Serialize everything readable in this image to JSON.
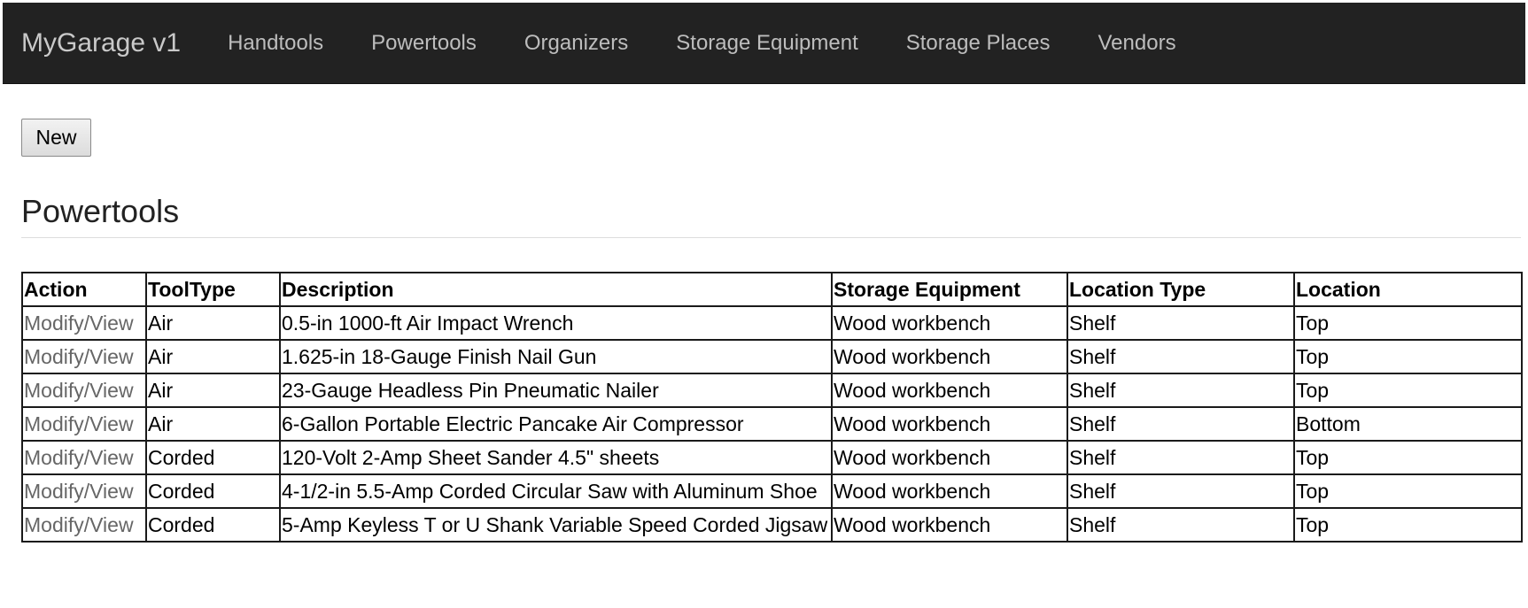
{
  "navbar": {
    "brand": "MyGarage v1",
    "items": [
      {
        "label": "Handtools"
      },
      {
        "label": "Powertools"
      },
      {
        "label": "Organizers"
      },
      {
        "label": "Storage Equipment"
      },
      {
        "label": "Storage Places"
      },
      {
        "label": "Vendors"
      }
    ]
  },
  "toolbar": {
    "new_label": "New"
  },
  "page": {
    "title": "Powertools"
  },
  "table": {
    "headers": [
      "Action",
      "ToolType",
      "Description",
      "Storage Equipment",
      "Location Type",
      "Location"
    ],
    "rows": [
      {
        "action": "Modify/View",
        "tooltype": "Air",
        "description": "0.5-in 1000-ft Air Impact Wrench",
        "storage_equipment": "Wood workbench",
        "location_type": "Shelf",
        "location": "Top"
      },
      {
        "action": "Modify/View",
        "tooltype": "Air",
        "description": "1.625-in 18-Gauge Finish Nail Gun",
        "storage_equipment": "Wood workbench",
        "location_type": "Shelf",
        "location": "Top"
      },
      {
        "action": "Modify/View",
        "tooltype": "Air",
        "description": "23-Gauge Headless Pin Pneumatic Nailer",
        "storage_equipment": "Wood workbench",
        "location_type": "Shelf",
        "location": "Top"
      },
      {
        "action": "Modify/View",
        "tooltype": "Air",
        "description": "6-Gallon Portable Electric Pancake Air Compressor",
        "storage_equipment": "Wood workbench",
        "location_type": "Shelf",
        "location": "Bottom"
      },
      {
        "action": "Modify/View",
        "tooltype": "Corded",
        "description": "120-Volt 2-Amp Sheet Sander 4.5\" sheets",
        "storage_equipment": "Wood workbench",
        "location_type": "Shelf",
        "location": "Top"
      },
      {
        "action": "Modify/View",
        "tooltype": "Corded",
        "description": "4-1/2-in 5.5-Amp Corded Circular Saw with Aluminum Shoe",
        "storage_equipment": "Wood workbench",
        "location_type": "Shelf",
        "location": "Top"
      },
      {
        "action": "Modify/View",
        "tooltype": "Corded",
        "description": "5-Amp Keyless T or U Shank Variable Speed Corded Jigsaw",
        "storage_equipment": "Wood workbench",
        "location_type": "Shelf",
        "location": "Top"
      }
    ]
  }
}
